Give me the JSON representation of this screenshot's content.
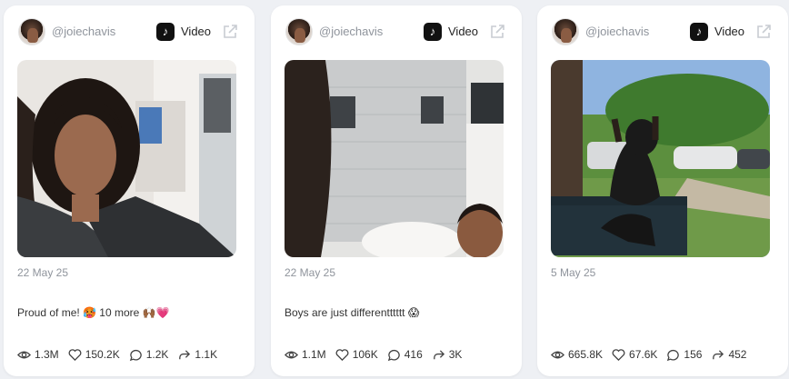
{
  "posts": [
    {
      "username": "@joiechavis",
      "platform_icon": "tiktok-icon",
      "type_label": "Video",
      "date": "22 May 25",
      "caption": "Proud of me! 🥵 10 more 🙌🏾💗",
      "stats": {
        "views": "1.3M",
        "likes": "150.2K",
        "comments": "1.2K",
        "shares": "1.1K"
      },
      "thumbnail": "selfie-woman-curly-hair"
    },
    {
      "username": "@joiechavis",
      "platform_icon": "tiktok-icon",
      "type_label": "Video",
      "date": "22 May 25",
      "caption": "Boys are just differentttttt 😱",
      "stats": {
        "views": "1.1M",
        "likes": "106K",
        "comments": "416",
        "shares": "3K"
      },
      "thumbnail": "bathroom-with-child"
    },
    {
      "username": "@joiechavis",
      "platform_icon": "tiktok-icon",
      "type_label": "Video",
      "date": "5 May 25",
      "caption": "",
      "stats": {
        "views": "665.8K",
        "likes": "67.6K",
        "comments": "156",
        "shares": "452"
      },
      "thumbnail": "woman-on-bench-outdoors"
    }
  ],
  "colors": {
    "background": "#eef0f4",
    "card": "#ffffff",
    "muted_text": "#8f949c",
    "text": "#333333"
  }
}
